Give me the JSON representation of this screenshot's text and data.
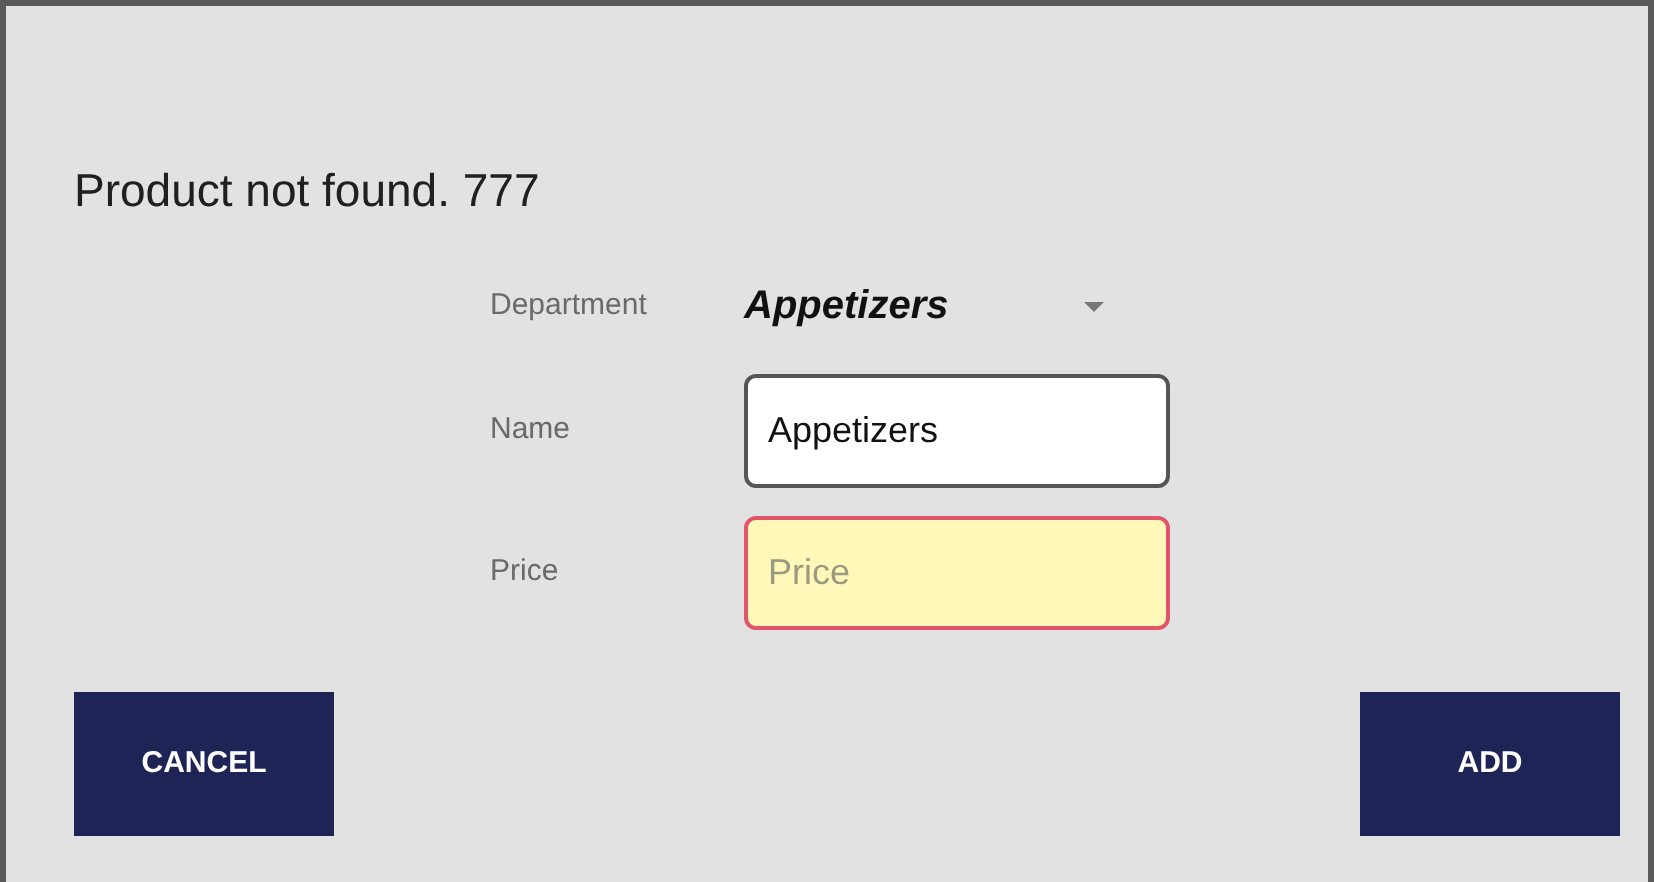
{
  "dialog": {
    "title": "Product not found. 777"
  },
  "fields": [
    {
      "kind": "dropdown",
      "label": "Department",
      "value": "Appetizers",
      "error": false
    },
    {
      "kind": "text",
      "label": "Name",
      "value": "Appetizers",
      "error": false
    },
    {
      "kind": "text",
      "label": "Price",
      "placeholder": "Price",
      "error": true
    }
  ],
  "buttons": [
    "CANCEL",
    "ADD"
  ]
}
